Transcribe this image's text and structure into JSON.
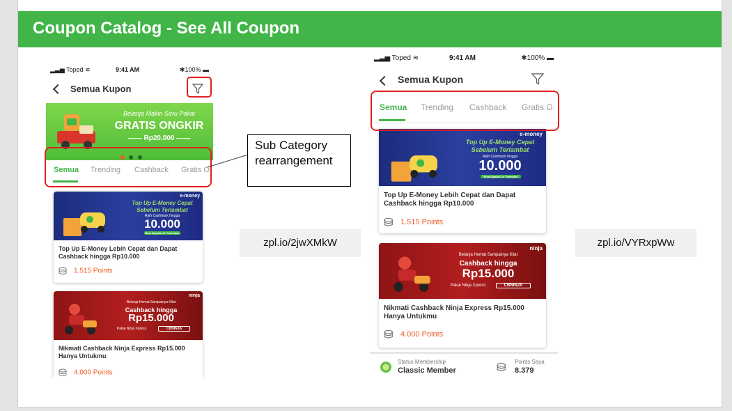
{
  "slide": {
    "title": "Coupon Catalog - See All Coupon",
    "callout_text": "Sub Category rearrangement",
    "link_left": "zpl.io/2jwXMkW",
    "link_right": "zpl.io/VYRxpWw",
    "highlight_color": "#e02020",
    "header_color": "#42b549"
  },
  "left_phone": {
    "status": {
      "carrier": "Toped",
      "time": "9:41 AM",
      "battery": "100%"
    },
    "nav_title": "Semua Kupon",
    "promo_banner": {
      "line1": "Belanja Makin Seru Pakai",
      "line2": "GRATIS ONGKIR",
      "line3": "Rp20.000"
    },
    "tabs": [
      "Semua",
      "Trending",
      "Cashback",
      "Gratis O"
    ],
    "cards": [
      {
        "banner_brand": "e-money",
        "banner_line1": "Top Up E-Money Cepat",
        "banner_line2": "Sebelum Terlambat",
        "banner_line3": "Raih Cashback hingga",
        "banner_amount": "10.000",
        "banner_cta": "Bisa Dipakai 2x Transaksi",
        "title": "Top Up E-Money Lebih Cepat dan Dapat Cashback hingga Rp10.000",
        "points": "1.515 Points"
      },
      {
        "banner_brand": "ninja",
        "banner_line1": "Belanja Hemat Sampainya Kilat",
        "banner_line2": "Cashback hingga",
        "banner_amount": "Rp15.000",
        "banner_line3": "Pakai Ninja Xpress",
        "banner_code": "CBNINJA",
        "title": "Nikmati Cashback Ninja Express Rp15.000 Hanya Untukmu",
        "points": "4.000 Points"
      }
    ]
  },
  "right_phone": {
    "status": {
      "carrier": "Toped",
      "time": "9:41 AM",
      "battery": "100%"
    },
    "nav_title": "Semua Kupon",
    "tabs": [
      "Semua",
      "Trending",
      "Cashback",
      "Gratis O"
    ],
    "cards": [
      {
        "banner_brand": "e-money",
        "banner_line1": "Top Up E-Money Cepat",
        "banner_line2": "Sebelum Terlambat",
        "banner_line3": "Raih Cashback hingga",
        "banner_amount": "10.000",
        "banner_cta": "Bisa Dipakai 2x Transaksi",
        "title": "Top Up E-Money Lebih Cepat dan Dapat Cashback hingga Rp10.000",
        "points": "1.515 Points"
      },
      {
        "banner_brand": "ninja",
        "banner_line1": "Belanja Hemat Sampainya Kilat",
        "banner_line2": "Cashback hingga",
        "banner_amount": "Rp15.000",
        "banner_line3": "Pakai Ninja Xpress",
        "banner_code": "CBNINJA",
        "title": "Nikmati Cashback Ninja Express Rp15.000 Hanya Untukmu",
        "points": "4.000 Points"
      }
    ],
    "membership": {
      "status_label": "Status Membership",
      "status_value": "Classic Member",
      "points_label": "Points Saya",
      "points_value": "8.379"
    }
  }
}
